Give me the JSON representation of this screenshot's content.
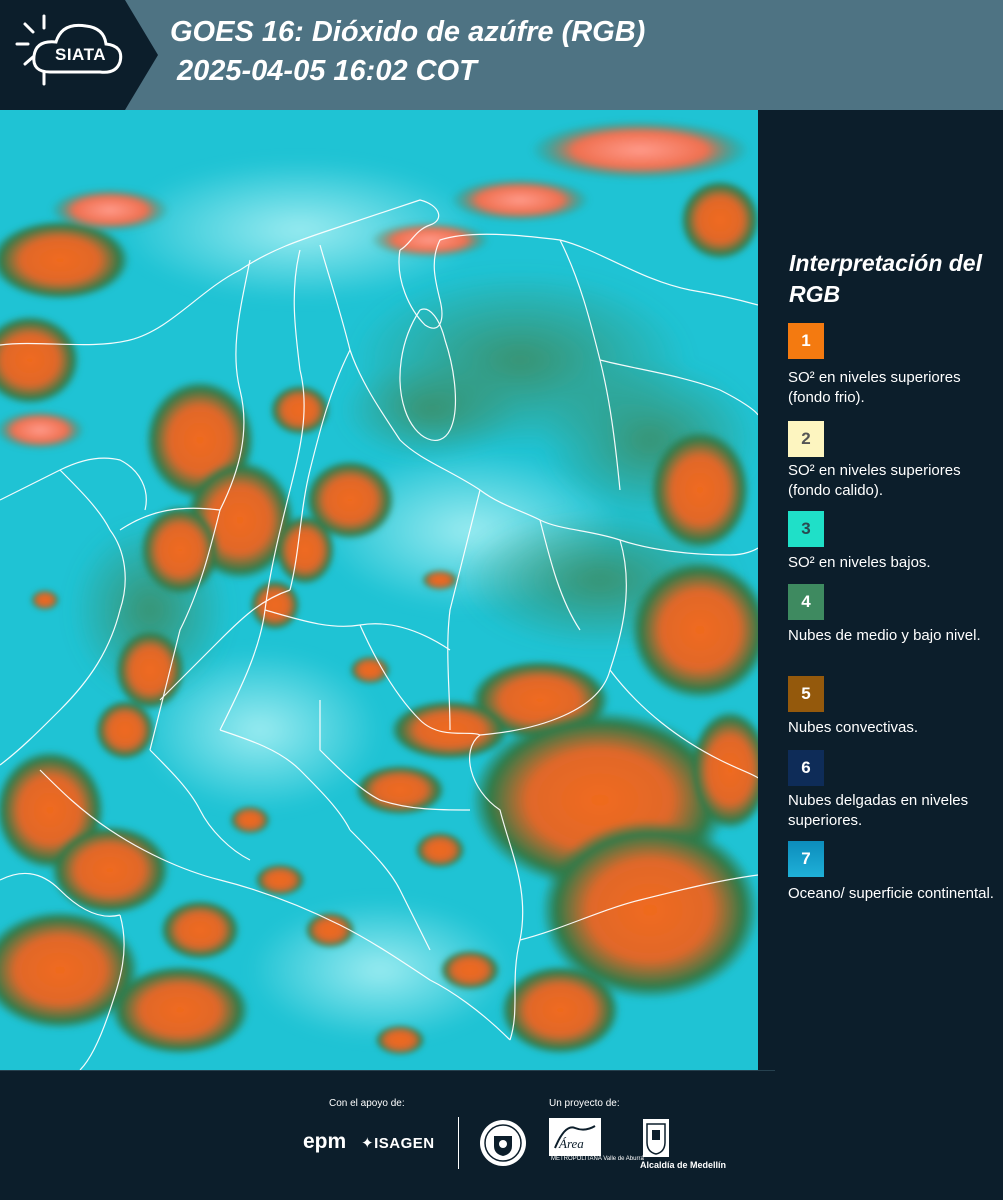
{
  "header": {
    "logo_text": "SIATA",
    "title_line1": "GOES 16: Dióxido de azúfre (RGB)",
    "title_line2": "2025-04-05 16:02 COT"
  },
  "colors": {
    "header_bg": "#4e7383",
    "logo_plate": "#0c1e2b",
    "page_bg": "#0c1e2b",
    "ocean_cyan": "#1fc3d4",
    "cloud_orange": "#f06a1e",
    "cloud_green": "#2f7a48",
    "border_lines": "#ffffff"
  },
  "legend": {
    "title": "Interpretación del RGB",
    "items": [
      {
        "number": "1",
        "text": "SO² en niveles superiores (fondo frio).",
        "color": "#f47a10"
      },
      {
        "number": "2",
        "text": "SO² en niveles superiores (fondo calido).",
        "color": "#fdf5c0"
      },
      {
        "number": "3",
        "text": "SO² en niveles bajos.",
        "color": "#1fe0c8"
      },
      {
        "number": "4",
        "text": "Nubes de medio y bajo nivel.",
        "color": "#3e8a60"
      },
      {
        "number": "5",
        "text": "Nubes convectivas.",
        "color": "#94590c"
      },
      {
        "number": "6",
        "text": "Nubes delgadas en niveles superiores.",
        "color": "#0e2c58"
      },
      {
        "number": "7",
        "text": "Oceano/ superficie continental.",
        "color": "#0c8cbc"
      }
    ]
  },
  "footer": {
    "support_caption": "Con el apoyo de:",
    "project_caption": "Un proyecto de:",
    "epm_logo": "epm",
    "isagen_logo": "ISAGEN",
    "area_logo": "Área",
    "area_caption": "METROPOLITANA Valle de Aburrá",
    "alcaldia_caption": "Alcaldía de Medellín"
  }
}
